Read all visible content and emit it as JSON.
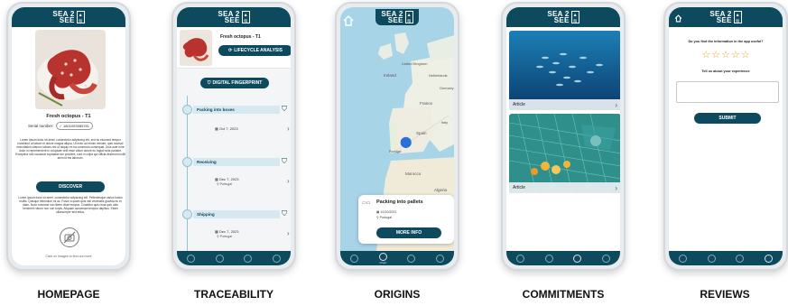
{
  "brand": {
    "line1": "SEA 2",
    "line2": "SEE"
  },
  "labels": {
    "homepage": "HOMEPAGE",
    "traceability": "TRACEABILITY",
    "origins": "ORIGINS",
    "commitments": "COMMITMENTS",
    "reviews": "REVIEWS"
  },
  "homepage": {
    "product_name": "Fresh octopus - T1",
    "serial_label": "Serial number:",
    "serial_value": "1801093589781",
    "para1": "Lorem ipsum dolor sit amet, consectetur adipiscing elit, sed do eiusmod tempor incididunt ut labore et dolore magna aliqua. Ut enim ad minim veniam, quis nostrud exercitation ullamco laboris nisi ut aliquip ex ea commodo consequat. Duis aute irure dolor in reprehenderit in voluptate velit esse cillum dolore eu fugiat nulla pariatur. Excepteur sint occaecat cupidatat non proident, sunt in culpa qui officia deserunt mollit anim id est laborum.",
    "discover_label": "DISCOVER",
    "para2": "Lorem ipsum dolor sit amet, consectetur adipiscing elit. Pellentesque varius luctus mollis. Quisque bibendum mi ac. Fusce a quam quis nisl venenatis gravida eu et diam. Nunc euismod non libero vitae tempus. Curabitur quis risus quis odio hendrerit rutrum non non turpis. Aliquam accumsan tempus dapibus. Etiam ullamcorper sed tellus.",
    "click_hint": "Click on images to find out more"
  },
  "traceability": {
    "product_name": "Fresh octopus - T1",
    "lifecycle_label": "LIFECYCLE ANALYSIS",
    "fingerprint_label": "DIGITAL FINGERPRINT",
    "steps": [
      {
        "title": "Packing into boxes",
        "date": "Oct 7, 2023",
        "place": ""
      },
      {
        "title": "Receiving",
        "date": "Dec 7, 2023",
        "place": "Portugal"
      },
      {
        "title": "Shipping",
        "date": "Dec 7, 2023",
        "place": "Portugal"
      }
    ]
  },
  "origins": {
    "map_labels": [
      "Ireland",
      "United Kingdom",
      "France",
      "Spain",
      "Portugal",
      "Morocco",
      "Algeria",
      "Netherlands",
      "Germany",
      "Italy"
    ],
    "popup_title": "Packing into pallets",
    "popup_date": "10/10/2022",
    "popup_place": "Portugal",
    "more_info_label": "MORE INFO",
    "nav_label": "Origin"
  },
  "commitments": {
    "cards": [
      {
        "label": "Article"
      },
      {
        "label": "Article"
      }
    ]
  },
  "reviews": {
    "question": "Do you find the information in the app useful?",
    "stars": 5,
    "stars_filled": 0,
    "experience_label": "Tell us about your experience",
    "submit_label": "SUBMIT"
  },
  "colors": {
    "primary": "#0e4a5e",
    "accent_light": "#d7e9f0",
    "star": "#e3a527"
  }
}
